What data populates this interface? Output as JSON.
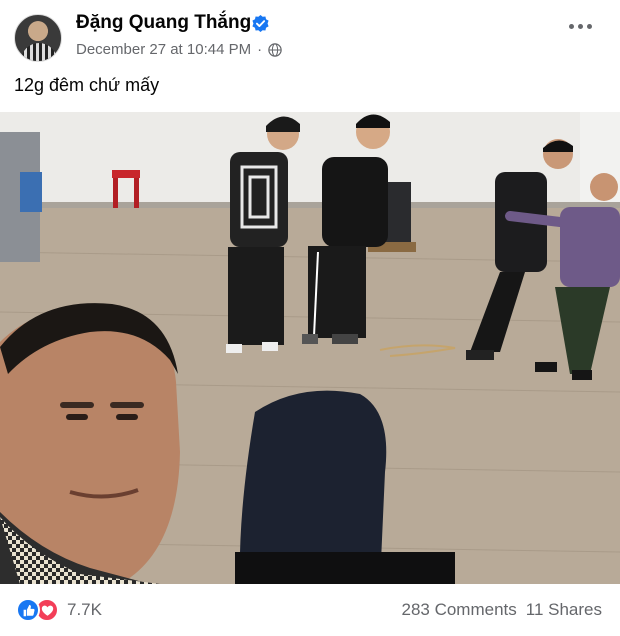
{
  "post": {
    "author": "Đặng Quang Thắng",
    "timestamp": "December 27 at 10:44 PM",
    "separator": "·",
    "audience_icon": "globe-icon",
    "verified_icon": "verified-badge-icon",
    "text": "12g đêm chứ mấy"
  },
  "photo": {
    "description_icon": "group-selfie-photo"
  },
  "footer": {
    "reaction_icons": [
      "like-icon",
      "love-icon"
    ],
    "reaction_count": "7.7K",
    "comments": "283 Comments",
    "shares": "11 Shares"
  },
  "colors": {
    "meta_gray": "#65676b",
    "like_blue": "#1877f2",
    "love_red": "#f33e58"
  }
}
